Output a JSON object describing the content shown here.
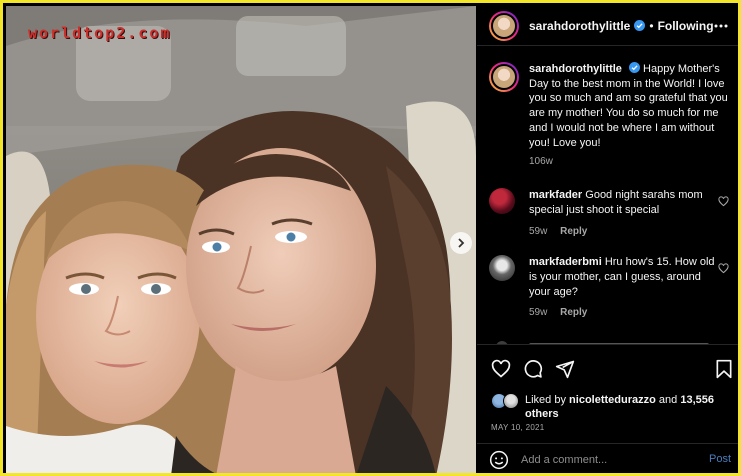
{
  "watermark": "worldtop2.com",
  "post": {
    "username": "sarahdorothylittle",
    "separator": "•",
    "follow_status": "Following",
    "caption_user": "sarahdorothylittle",
    "caption": "Happy Mother's Day to the best mom in the World! I love you so much and am so grateful that you are my mother! You do so much for me and I would not be where I am without you! Love you!",
    "caption_age": "106w"
  },
  "comments": [
    {
      "user": "markfader",
      "text": "Good night sarahs mom special just shoot it special",
      "age": "59w",
      "reply_label": "Reply"
    },
    {
      "user": "markfaderbmi",
      "text": "Hru how's 15. How old is your mother, can I guess, around your age?",
      "age": "59w",
      "reply_label": "Reply"
    }
  ],
  "likes": {
    "prefix": "Liked by",
    "user": "nicolettedurazzo",
    "conjunction": "and",
    "count": "13,556",
    "suffix": "others"
  },
  "date": "MAY 10, 2021",
  "comment_box": {
    "placeholder": "Add a comment...",
    "post_label": "Post"
  },
  "icons": {
    "more": "more-options-icon",
    "verified": "verified-badge-icon",
    "like": "heart-icon",
    "comment": "comment-icon",
    "share": "share-icon",
    "save": "bookmark-icon",
    "emoji": "emoji-icon",
    "next": "chevron-right-icon"
  },
  "colors": {
    "frame": "#f3e629",
    "background": "#000000",
    "secondary_text": "#a8a8a8",
    "link_blue": "#4b7dbb",
    "verified_blue": "#3897f0",
    "watermark": "#c9302c"
  }
}
